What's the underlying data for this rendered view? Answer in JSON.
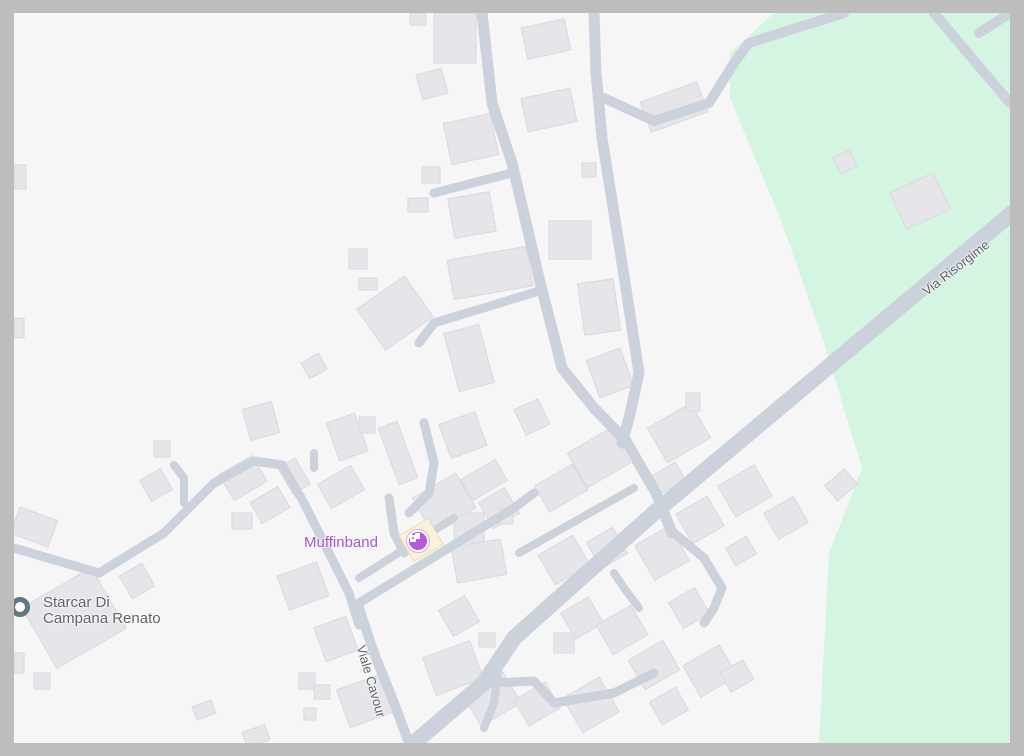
{
  "map": {
    "background_color": "#f6f6f7",
    "park_color": "#d3f5e1",
    "road_color": "#cbd2db",
    "building_color": "#e6e6ea"
  },
  "streets": {
    "via_risorgimento": "Via Risorgime",
    "viale_cavour": "Viale Cavour"
  },
  "pois": {
    "muffinband": {
      "name": "Muffinband",
      "color": "#a256d0",
      "icon": "cafe-icon"
    },
    "starcar": {
      "line1": "Starcar Di",
      "line2": "Campana Renato",
      "color": "#5f6368",
      "icon": "place-pin-icon"
    }
  }
}
